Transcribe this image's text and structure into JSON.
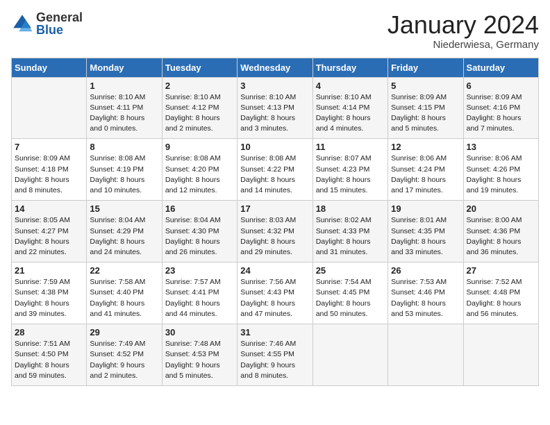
{
  "header": {
    "logo_general": "General",
    "logo_blue": "Blue",
    "month": "January 2024",
    "location": "Niederwiesa, Germany"
  },
  "days_of_week": [
    "Sunday",
    "Monday",
    "Tuesday",
    "Wednesday",
    "Thursday",
    "Friday",
    "Saturday"
  ],
  "weeks": [
    [
      {
        "day": null,
        "info": null
      },
      {
        "day": "1",
        "info": "Sunrise: 8:10 AM\nSunset: 4:11 PM\nDaylight: 8 hours\nand 0 minutes."
      },
      {
        "day": "2",
        "info": "Sunrise: 8:10 AM\nSunset: 4:12 PM\nDaylight: 8 hours\nand 2 minutes."
      },
      {
        "day": "3",
        "info": "Sunrise: 8:10 AM\nSunset: 4:13 PM\nDaylight: 8 hours\nand 3 minutes."
      },
      {
        "day": "4",
        "info": "Sunrise: 8:10 AM\nSunset: 4:14 PM\nDaylight: 8 hours\nand 4 minutes."
      },
      {
        "day": "5",
        "info": "Sunrise: 8:09 AM\nSunset: 4:15 PM\nDaylight: 8 hours\nand 5 minutes."
      },
      {
        "day": "6",
        "info": "Sunrise: 8:09 AM\nSunset: 4:16 PM\nDaylight: 8 hours\nand 7 minutes."
      }
    ],
    [
      {
        "day": "7",
        "info": "Sunrise: 8:09 AM\nSunset: 4:18 PM\nDaylight: 8 hours\nand 8 minutes."
      },
      {
        "day": "8",
        "info": "Sunrise: 8:08 AM\nSunset: 4:19 PM\nDaylight: 8 hours\nand 10 minutes."
      },
      {
        "day": "9",
        "info": "Sunrise: 8:08 AM\nSunset: 4:20 PM\nDaylight: 8 hours\nand 12 minutes."
      },
      {
        "day": "10",
        "info": "Sunrise: 8:08 AM\nSunset: 4:22 PM\nDaylight: 8 hours\nand 14 minutes."
      },
      {
        "day": "11",
        "info": "Sunrise: 8:07 AM\nSunset: 4:23 PM\nDaylight: 8 hours\nand 15 minutes."
      },
      {
        "day": "12",
        "info": "Sunrise: 8:06 AM\nSunset: 4:24 PM\nDaylight: 8 hours\nand 17 minutes."
      },
      {
        "day": "13",
        "info": "Sunrise: 8:06 AM\nSunset: 4:26 PM\nDaylight: 8 hours\nand 19 minutes."
      }
    ],
    [
      {
        "day": "14",
        "info": "Sunrise: 8:05 AM\nSunset: 4:27 PM\nDaylight: 8 hours\nand 22 minutes."
      },
      {
        "day": "15",
        "info": "Sunrise: 8:04 AM\nSunset: 4:29 PM\nDaylight: 8 hours\nand 24 minutes."
      },
      {
        "day": "16",
        "info": "Sunrise: 8:04 AM\nSunset: 4:30 PM\nDaylight: 8 hours\nand 26 minutes."
      },
      {
        "day": "17",
        "info": "Sunrise: 8:03 AM\nSunset: 4:32 PM\nDaylight: 8 hours\nand 29 minutes."
      },
      {
        "day": "18",
        "info": "Sunrise: 8:02 AM\nSunset: 4:33 PM\nDaylight: 8 hours\nand 31 minutes."
      },
      {
        "day": "19",
        "info": "Sunrise: 8:01 AM\nSunset: 4:35 PM\nDaylight: 8 hours\nand 33 minutes."
      },
      {
        "day": "20",
        "info": "Sunrise: 8:00 AM\nSunset: 4:36 PM\nDaylight: 8 hours\nand 36 minutes."
      }
    ],
    [
      {
        "day": "21",
        "info": "Sunrise: 7:59 AM\nSunset: 4:38 PM\nDaylight: 8 hours\nand 39 minutes."
      },
      {
        "day": "22",
        "info": "Sunrise: 7:58 AM\nSunset: 4:40 PM\nDaylight: 8 hours\nand 41 minutes."
      },
      {
        "day": "23",
        "info": "Sunrise: 7:57 AM\nSunset: 4:41 PM\nDaylight: 8 hours\nand 44 minutes."
      },
      {
        "day": "24",
        "info": "Sunrise: 7:56 AM\nSunset: 4:43 PM\nDaylight: 8 hours\nand 47 minutes."
      },
      {
        "day": "25",
        "info": "Sunrise: 7:54 AM\nSunset: 4:45 PM\nDaylight: 8 hours\nand 50 minutes."
      },
      {
        "day": "26",
        "info": "Sunrise: 7:53 AM\nSunset: 4:46 PM\nDaylight: 8 hours\nand 53 minutes."
      },
      {
        "day": "27",
        "info": "Sunrise: 7:52 AM\nSunset: 4:48 PM\nDaylight: 8 hours\nand 56 minutes."
      }
    ],
    [
      {
        "day": "28",
        "info": "Sunrise: 7:51 AM\nSunset: 4:50 PM\nDaylight: 8 hours\nand 59 minutes."
      },
      {
        "day": "29",
        "info": "Sunrise: 7:49 AM\nSunset: 4:52 PM\nDaylight: 9 hours\nand 2 minutes."
      },
      {
        "day": "30",
        "info": "Sunrise: 7:48 AM\nSunset: 4:53 PM\nDaylight: 9 hours\nand 5 minutes."
      },
      {
        "day": "31",
        "info": "Sunrise: 7:46 AM\nSunset: 4:55 PM\nDaylight: 9 hours\nand 8 minutes."
      },
      {
        "day": null,
        "info": null
      },
      {
        "day": null,
        "info": null
      },
      {
        "day": null,
        "info": null
      }
    ]
  ]
}
